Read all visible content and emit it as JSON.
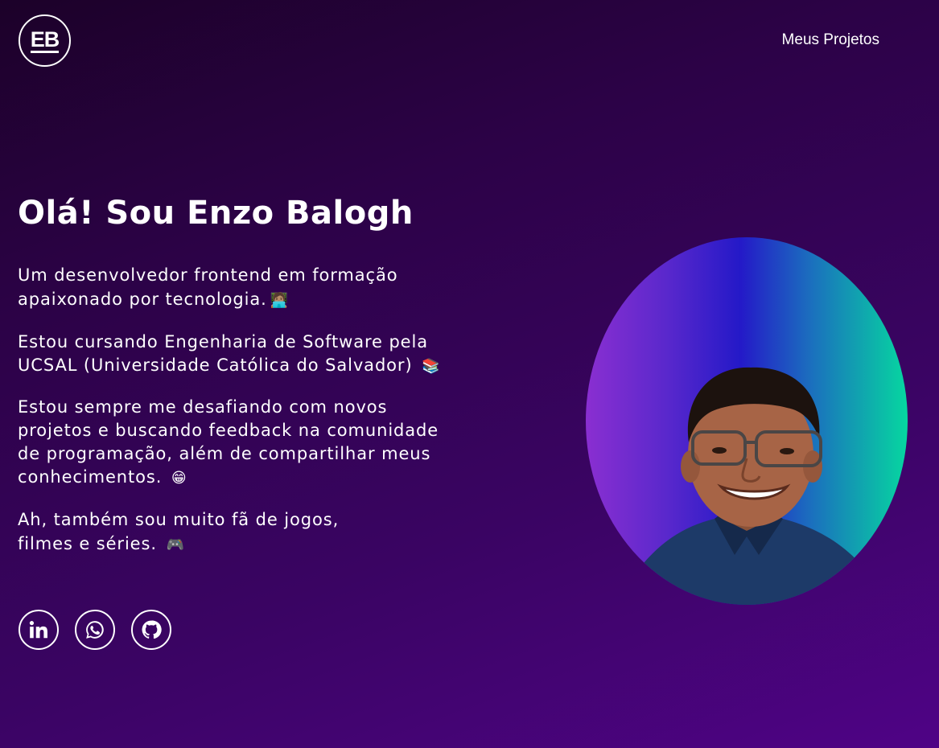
{
  "header": {
    "logo_text": "EB",
    "nav_link": "Meus Projetos"
  },
  "intro": {
    "title": "Olá! Sou Enzo Balogh",
    "paragraphs": [
      {
        "text": "Um desenvolvedor frontend em formação apaixonado por tecnologia.",
        "emoji": "🧑🏽‍💻"
      },
      {
        "text": "Estou cursando Engenharia de Software pela UCSAL (Universidade Católica do Salvador)",
        "emoji": "📚"
      },
      {
        "text": "Estou sempre me desafiando com novos projetos e buscando feedback na comunidade de programação, além de compartilhar meus conhecimentos.",
        "emoji": "😁"
      },
      {
        "text": "Ah, também sou muito fã de jogos, filmes e séries.",
        "emoji": "🎮"
      }
    ]
  },
  "socials": [
    {
      "icon": "linkedin-icon"
    },
    {
      "icon": "whatsapp-icon"
    },
    {
      "icon": "github-icon"
    }
  ],
  "photo": {
    "icon": "profile-photo",
    "gradient_colors": [
      "#8a2fd1",
      "#2419c8",
      "#06d7a0"
    ]
  }
}
